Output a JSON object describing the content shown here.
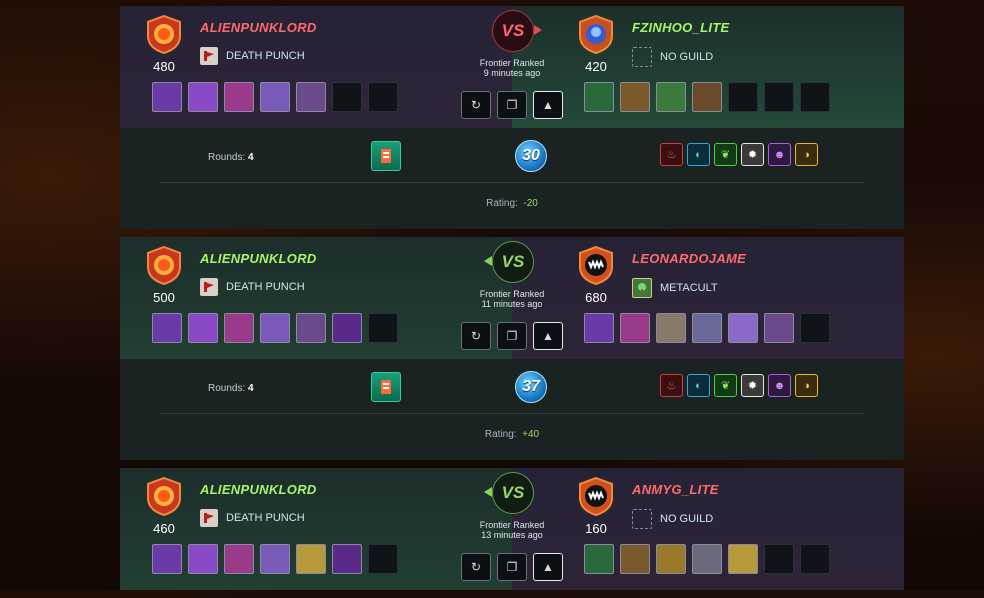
{
  "battles": [
    {
      "left": {
        "name": "ALIENPUNKLORD",
        "rating": "480",
        "guild": "DEATH PUNCH",
        "result": "lose"
      },
      "right": {
        "name": "FZINHOO_LITE",
        "rating": "420",
        "guild": "NO GUILD",
        "result": "win"
      },
      "vs": "VS",
      "format": "Frontier Ranked",
      "time": "9 minutes ago",
      "rounds_label": "Rounds:",
      "rounds": "4",
      "mana": "30",
      "rating_label": "Rating:",
      "rating_change": "-20",
      "left_cards": [
        "#6a3aa8",
        "#8a4ac8",
        "#9a3a8a",
        "#7a5ab8",
        "#6a4a8a"
      ],
      "right_cards": [
        "#2a6a3a",
        "#7a5a2a",
        "#3a7a3a",
        "#6a4a2a"
      ]
    },
    {
      "left": {
        "name": "ALIENPUNKLORD",
        "rating": "500",
        "guild": "DEATH PUNCH",
        "result": "win"
      },
      "right": {
        "name": "LEONARDOJAME",
        "rating": "680",
        "guild": "METACULT",
        "result": "lose"
      },
      "vs": "VS",
      "format": "Frontier Ranked",
      "time": "11 minutes ago",
      "rounds_label": "Rounds:",
      "rounds": "4",
      "mana": "37",
      "rating_label": "Rating:",
      "rating_change": "+40",
      "left_cards": [
        "#6a3aa8",
        "#8a4ac8",
        "#9a3a8a",
        "#7a5ab8",
        "#6a4a8a",
        "#5a2a8a"
      ],
      "right_cards": [
        "#6a3aa8",
        "#9a3a8a",
        "#8a7a6a",
        "#6a6a9a",
        "#8a6ac8",
        "#6a4a8a"
      ]
    },
    {
      "left": {
        "name": "ALIENPUNKLORD",
        "rating": "460",
        "guild": "DEATH PUNCH",
        "result": "win"
      },
      "right": {
        "name": "ANMYG_LITE",
        "rating": "160",
        "guild": "NO GUILD",
        "result": "lose"
      },
      "vs": "VS",
      "format": "Frontier Ranked",
      "time": "13 minutes ago",
      "left_cards": [
        "#6a3aa8",
        "#8a4ac8",
        "#9a3a8a",
        "#7a5ab8",
        "#b89a3a",
        "#5a2a8a"
      ],
      "right_cards": [
        "#2a6a3a",
        "#7a5a2a",
        "#9a7a2a",
        "#6a6a7a",
        "#b89a3a"
      ]
    }
  ],
  "elements": [
    "fire",
    "water",
    "earth",
    "life",
    "death",
    "dragon"
  ],
  "icons": {
    "replay": "replay-icon",
    "copy": "copy-icon",
    "expand": "caret-up-icon"
  }
}
